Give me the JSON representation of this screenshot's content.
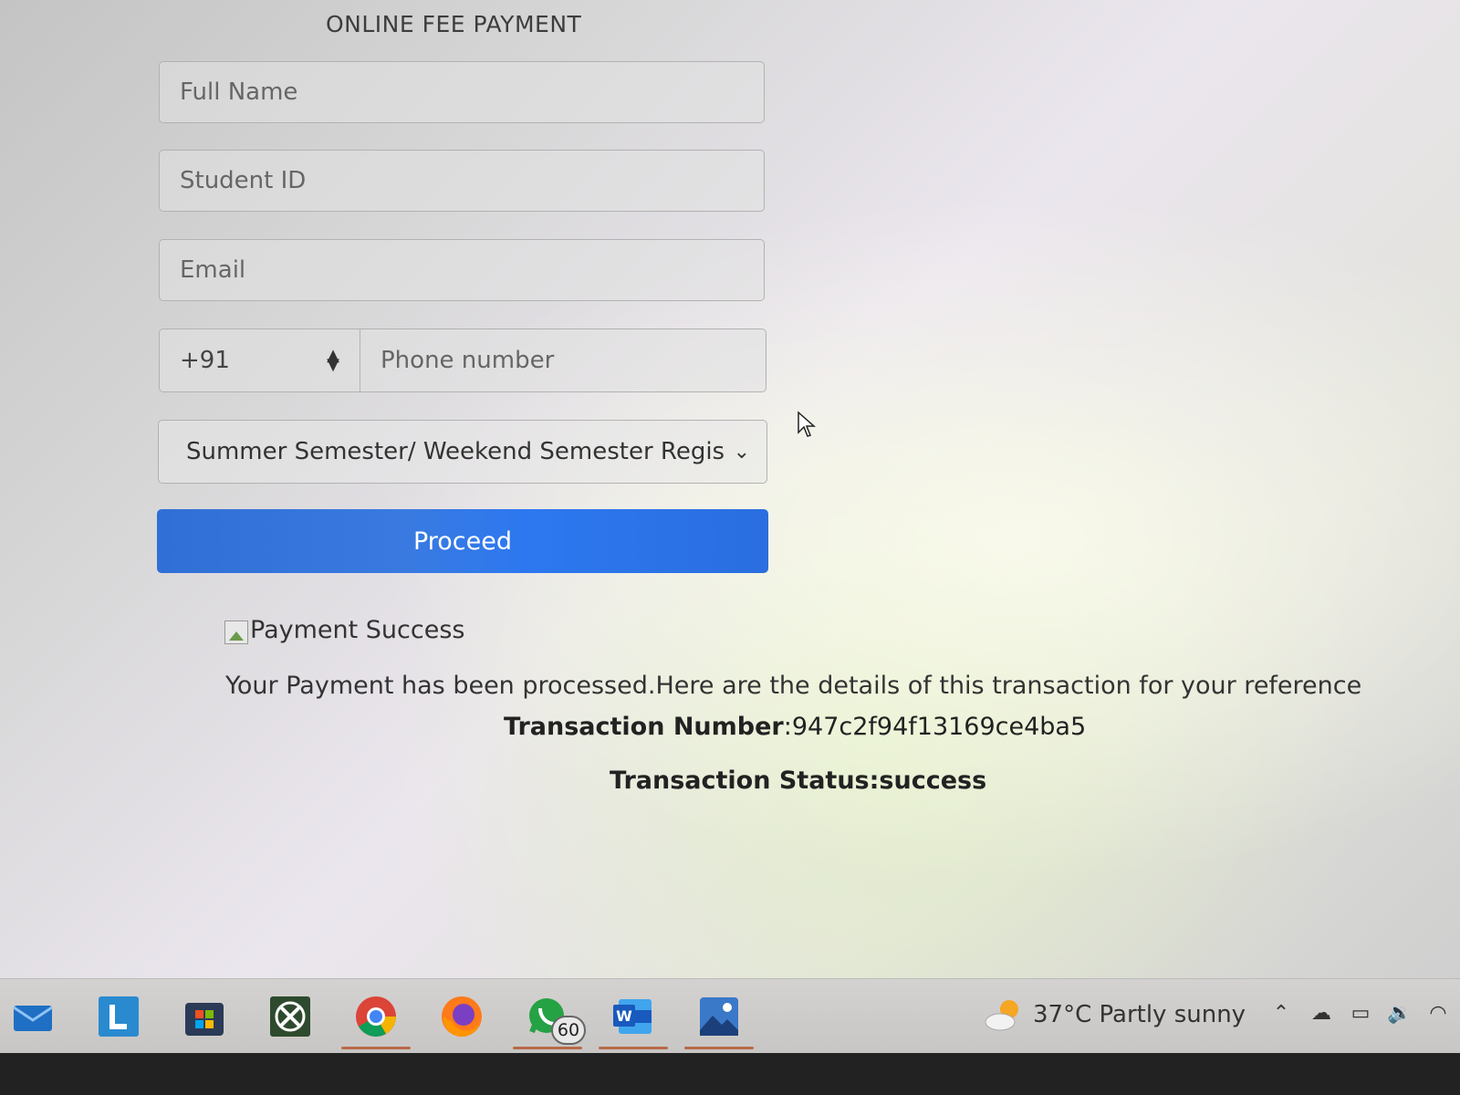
{
  "form": {
    "title": "ONLINE FEE PAYMENT",
    "full_name_placeholder": "Full Name",
    "student_id_placeholder": "Student ID",
    "email_placeholder": "Email",
    "country_code": "+91",
    "phone_placeholder": "Phone number",
    "semester_selected": "Summer Semester/ Weekend Semester Registration",
    "proceed_label": "Proceed"
  },
  "result": {
    "heading": "Payment Success",
    "message": "Your Payment has been processed.Here are the details of this transaction for your reference",
    "txn_number_label": "Transaction Number",
    "txn_number_value": ":947c2f94f13169ce4ba5",
    "txn_status_label": "Transaction Status",
    "txn_status_value": ":success"
  },
  "taskbar": {
    "apps": [
      "mail-icon",
      "l-app-icon",
      "store-icon",
      "xbox-icon",
      "chrome-icon",
      "firefox-icon",
      "whatsapp-icon",
      "word-icon",
      "photos-icon"
    ],
    "whatsapp_badge": "60",
    "weather_text": "37°C  Partly sunny"
  },
  "colors": {
    "primary": "#2f6fd6"
  }
}
